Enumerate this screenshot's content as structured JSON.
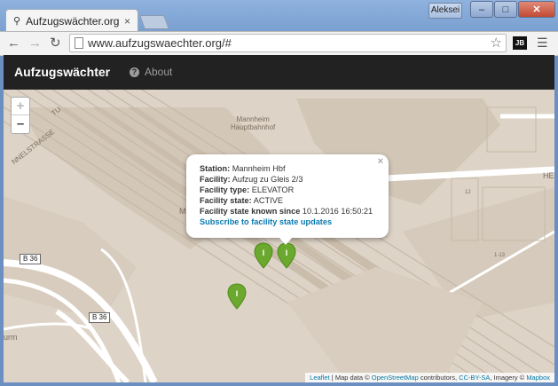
{
  "browser": {
    "tab_title": "Aufzugswächter.org",
    "tab_close": "×",
    "user_button": "Aleksei",
    "min": "–",
    "max": "□",
    "close": "✕",
    "url": "www.aufzugswaechter.org/#",
    "extension_label": "JB"
  },
  "app": {
    "brand": "Aufzugswächter",
    "nav_about": "About"
  },
  "map": {
    "zoom_in": "+",
    "zoom_out": "–",
    "labels": {
      "station": "Mannheim\nHauptbahnhof",
      "street_left": "NNELSTRASSE",
      "tu": "TU",
      "he": "HE",
      "m": "M",
      "urm": "urm",
      "num_12": "12",
      "num_113": "1-13"
    },
    "road_b36_a": "B 36",
    "road_b36_b": "B 36",
    "popup": {
      "station_label": "Station:",
      "station_value": "Mannheim Hbf",
      "facility_label": "Facility:",
      "facility_value": "Aufzug zu Gleis 2/3",
      "type_label": "Facility type:",
      "type_value": "ELEVATOR",
      "state_label": "Facility state:",
      "state_value": "ACTIVE",
      "known_label": "Facility state known since",
      "known_value": "10.1.2016 16:50:21",
      "subscribe": "Subscribe to facility state updates",
      "close": "×"
    },
    "marker_color": "#6aa82e",
    "attribution": {
      "leaflet": "Leaflet",
      "sep1": " | Map data © ",
      "osm": "OpenStreetMap",
      "sep2": " contributors, ",
      "license": "CC-BY-SA",
      "sep3": ", Imagery © ",
      "mapbox": "Mapbox"
    }
  }
}
